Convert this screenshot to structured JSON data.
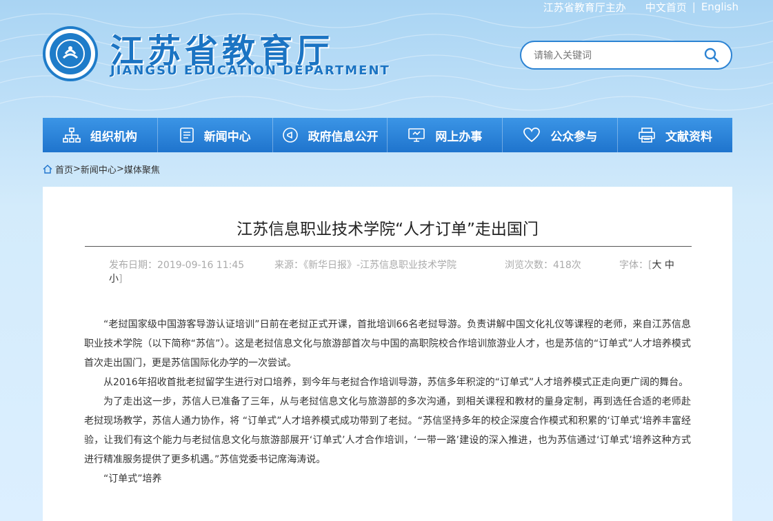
{
  "header": {
    "host_text": "江苏省教育厅主办",
    "link_cn": "中文首页",
    "divider": "|",
    "link_en": "English",
    "title_cn": "江苏省教育厅",
    "title_en": "JIANGSU EDUCATION DEPARTMENT",
    "search_placeholder": "请输入关键词",
    "search_icon": "search-icon"
  },
  "nav": {
    "items": [
      {
        "label": "组织机构",
        "icon": "org-chart-icon"
      },
      {
        "label": "新闻中心",
        "icon": "document-icon"
      },
      {
        "label": "政府信息公开",
        "icon": "megaphone-icon"
      },
      {
        "label": "网上办事",
        "icon": "monitor-icon"
      },
      {
        "label": "公众参与",
        "icon": "heart-icon"
      },
      {
        "label": "文献资料",
        "icon": "printer-icon"
      }
    ]
  },
  "breadcrumb": {
    "home": "首页",
    "sep1": ">",
    "news": "新闻中心",
    "sep2": ">",
    "current": "媒体聚焦"
  },
  "article": {
    "title": "江苏信息职业技术学院“人才订单”走出国门",
    "meta": {
      "pub_label": "发布日期：",
      "pub_value": "2019-09-16 11:45",
      "source_label": "来源：",
      "source_value": "《新华日报》-江苏信息职业技术学院",
      "views_label": "浏览次数：",
      "views_value": "418次",
      "font_label": "字体：",
      "bracket_open": "[",
      "font_large": "大",
      "font_medium": "中",
      "font_small": "小",
      "bracket_close": "]"
    },
    "paragraphs": [
      "“老挝国家级中国游客导游认证培训”日前在老挝正式开课，首批培训66名老挝导游。负责讲解中国文化礼仪等课程的老师，来自江苏信息职业技术学院（以下简称“苏信”）。这是老挝信息文化与旅游部首次与中国的高职院校合作培训旅游业人才，也是苏信的“订单式”人才培养模式首次走出国门，更是苏信国际化办学的一次尝试。",
      "从2016年招收首批老挝留学生进行对口培养，到今年与老挝合作培训导游，苏信多年积淀的“订单式”人才培养模式正走向更广阔的舞台。",
      "为了走出这一步，苏信人已准备了三年，从与老挝信息文化与旅游部的多次沟通，到相关课程和教材的量身定制，再到选任合适的老师赴老挝现场教学，苏信人通力协作，将 “订单式”人才培养模式成功带到了老挝。“苏信坚持多年的校企深度合作模式和积累的‘订单式’培养丰富经验，让我们有这个能力与老挝信息文化与旅游部展开‘订单式’人才合作培训，‘一带一路’建设的深入推进，也为苏信通过‘订单式’培养这种方式进行精准服务提供了更多机遇。”苏信党委书记席海涛说。",
      "“订单式”培养"
    ]
  },
  "colors": {
    "brand_blue": "#1b74c3",
    "nav_top": "#3b95e6",
    "nav_bottom": "#1f74cd"
  }
}
